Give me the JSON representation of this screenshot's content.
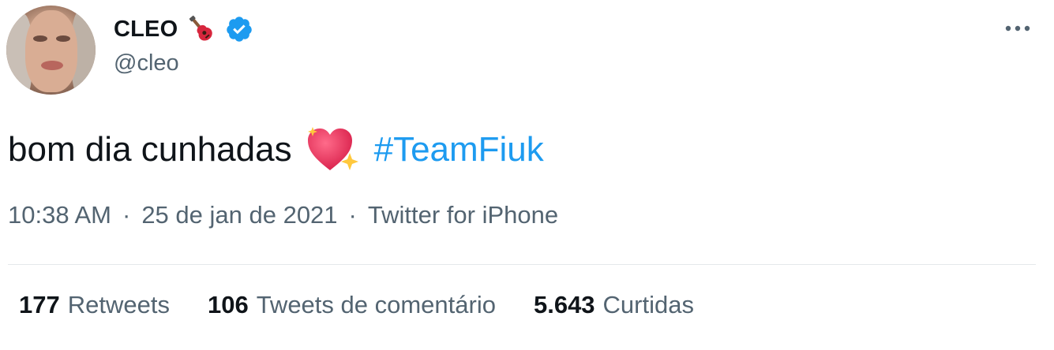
{
  "author": {
    "display_name": "CLEO",
    "handle": "@cleo",
    "name_emoji_icon": "guitar-icon",
    "verified_icon": "verified-badge-icon",
    "verified_color": "#1d9bf0"
  },
  "tweet": {
    "text": "bom dia cunhadas",
    "emoji_icon": "sparkling-heart-icon",
    "hashtag": "#TeamFiuk",
    "hashtag_color": "#1d9bf0"
  },
  "meta": {
    "time": "10:38 AM",
    "separator": "·",
    "date": "25 de jan de 2021",
    "source": "Twitter for iPhone"
  },
  "stats": {
    "retweets": {
      "count": "177",
      "label": "Retweets"
    },
    "quote_tweets": {
      "count": "106",
      "label": "Tweets de comentário"
    },
    "likes": {
      "count": "5.643",
      "label": "Curtidas"
    }
  },
  "more_icon": "more-options-icon",
  "colors": {
    "text_primary": "#0f1419",
    "text_secondary": "#536471",
    "accent": "#1d9bf0",
    "divider": "#e4e8eb"
  }
}
